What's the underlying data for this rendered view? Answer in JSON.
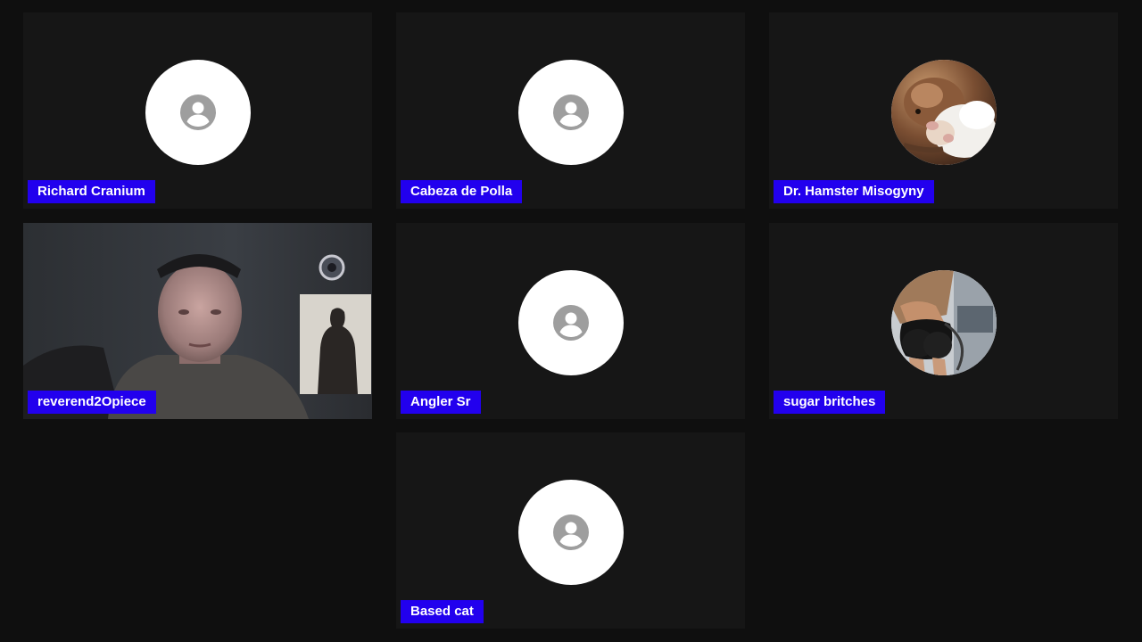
{
  "participants": [
    {
      "name": "Richard Cranium",
      "avatar": "person-icon"
    },
    {
      "name": "Cabeza de Polla",
      "avatar": "person-icon"
    },
    {
      "name": "Dr. Hamster Misogyny",
      "avatar": "hamster-photo"
    },
    {
      "name": "reverend2Opiece",
      "avatar": "live-video"
    },
    {
      "name": "Angler Sr",
      "avatar": "person-icon"
    },
    {
      "name": "sugar britches",
      "avatar": "profile-photo"
    },
    {
      "name": "Based cat",
      "avatar": "person-icon"
    }
  ],
  "colors": {
    "background": "#0f0f0f",
    "tile": "#161616",
    "name_tag": "#2200ee",
    "name_text": "#ffffff",
    "avatar_circle": "#ffffff",
    "avatar_icon": "#9e9e9e"
  }
}
